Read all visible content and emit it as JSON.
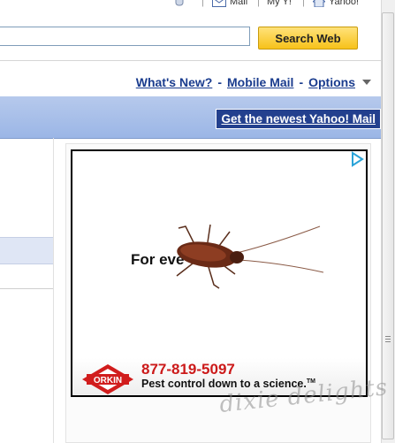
{
  "topbar": {
    "mail_label": "Mail",
    "myy_label": "My Y!",
    "yahoo_label": "Yahoo!"
  },
  "search": {
    "value": "",
    "button_label": "Search Web"
  },
  "links": {
    "whats_new": "What's New?",
    "mobile_mail": "Mobile Mail",
    "options": "Options",
    "separator": "-"
  },
  "banner": {
    "link_label": "Get the newest Yahoo! Mail"
  },
  "ad": {
    "headline": "For eve",
    "phone": "877-819-5097",
    "slogan": "Pest control down to a science.",
    "trademark": "TM",
    "logo_text": "ORKIN",
    "accent_color": "#cc1a1a"
  },
  "watermark": {
    "text": "dixie delights"
  },
  "colors": {
    "link": "#1a3c8e",
    "banner": "#a9c0ea",
    "search_button": "#f7c21a"
  }
}
